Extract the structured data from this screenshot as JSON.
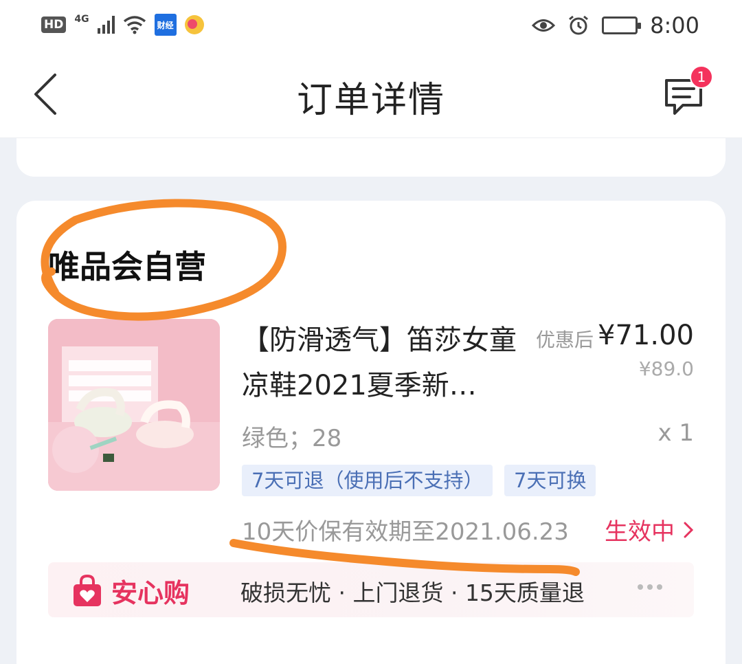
{
  "status_bar": {
    "hd": "HD",
    "network": "4G",
    "app_label": "财经",
    "time": "8:00"
  },
  "header": {
    "title": "订单详情",
    "message_badge": "1"
  },
  "order": {
    "shop_name": "唯品会自营",
    "product": {
      "title": "【防滑透气】笛莎女童凉鞋2021夏季新…",
      "price_label": "优惠后",
      "price_current": "¥71.00",
      "price_original": "¥89.0",
      "spec": "绿色；28",
      "quantity": "x 1",
      "tags": [
        "7天可退（使用后不支持）",
        "7天可换"
      ],
      "price_protect": "10天价保有效期至2021.06.23",
      "protect_status": "生效中"
    },
    "assurance": {
      "name": "安心购",
      "text": "破损无忧 · 上门退货 · 15天质量退"
    }
  },
  "colors": {
    "accent": "#e6335f",
    "badge": "#f4325c",
    "tag_bg": "#e9effb",
    "tag_text": "#4a6fb5",
    "annotation": "#f58a2c"
  },
  "icons": [
    "back-arrow-icon",
    "message-icon",
    "bag-heart-icon",
    "chevron-right-icon",
    "more-dots-icon",
    "eye-icon",
    "alarm-icon",
    "battery-icon",
    "wifi-icon",
    "signal-icon"
  ]
}
